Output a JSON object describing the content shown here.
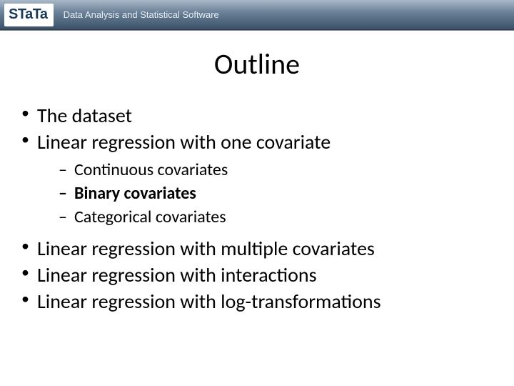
{
  "header": {
    "logo_text": "STaTa",
    "tagline": "Data Analysis and Statistical Software"
  },
  "title": "Outline",
  "bullets": {
    "b1": "The dataset",
    "b2": "Linear regression with one covariate",
    "b2_sub": {
      "s1": "Continuous covariates",
      "s2": "Binary covariates",
      "s3": "Categorical covariates"
    },
    "b3": "Linear regression with multiple covariates",
    "b4": "Linear regression with interactions",
    "b5": "Linear regression with log-transformations"
  }
}
